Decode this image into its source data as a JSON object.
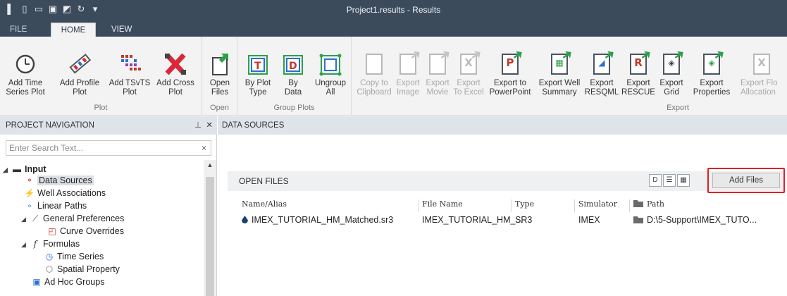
{
  "window": {
    "title": "Project1.results - Results"
  },
  "tabs": {
    "file": "FILE",
    "home": "HOME",
    "view": "VIEW"
  },
  "ribbon": {
    "plot_group": {
      "label": "Plot",
      "buttons": [
        {
          "line1": "Add Time",
          "line2": "Series Plot"
        },
        {
          "line1": "Add Profile",
          "line2": "Plot"
        },
        {
          "line1": "Add TSvTS",
          "line2": "Plot"
        },
        {
          "line1": "Add Cross",
          "line2": "Plot"
        }
      ]
    },
    "open_group": {
      "label": "Open",
      "buttons": [
        {
          "line1": "Open",
          "line2": "Files"
        }
      ]
    },
    "group_plots_group": {
      "label": "Group Plots",
      "buttons": [
        {
          "line1": "By Plot",
          "line2": "Type"
        },
        {
          "line1": "By",
          "line2": "Data"
        },
        {
          "line1": "Ungroup",
          "line2": "All"
        }
      ]
    },
    "export_group": {
      "label": "Export",
      "buttons": [
        {
          "line1": "Copy to",
          "line2": "Clipboard",
          "enabled": false
        },
        {
          "line1": "Export",
          "line2": "Image",
          "enabled": false
        },
        {
          "line1": "Export",
          "line2": "Movie",
          "enabled": false
        },
        {
          "line1": "Export",
          "line2": "To Excel",
          "enabled": false
        },
        {
          "line1": "Export to",
          "line2": "PowerPoint",
          "enabled": true
        },
        {
          "line1": "Export Well",
          "line2": "Summary",
          "enabled": true
        },
        {
          "line1": "Export",
          "line2": "RESQML",
          "enabled": true
        },
        {
          "line1": "Export",
          "line2": "RESCUE",
          "enabled": true
        },
        {
          "line1": "Export",
          "line2": "Grid",
          "enabled": true
        },
        {
          "line1": "Export",
          "line2": "Properties",
          "enabled": true
        },
        {
          "line1": "Export Flo",
          "line2": "Allocation",
          "enabled": false
        }
      ]
    }
  },
  "project_navigation": {
    "title": "PROJECT NAVIGATION",
    "search_placeholder": "Enter Search Text...",
    "tree": [
      {
        "label": "Input",
        "icon": "folder-icon"
      },
      {
        "label": "Data Sources",
        "icon": "data-sources-icon",
        "selected": true
      },
      {
        "label": "Well Associations",
        "icon": "well-associations-icon"
      },
      {
        "label": "Linear Paths",
        "icon": "linear-paths-icon"
      },
      {
        "label": "General Preferences",
        "icon": "wrench-icon"
      },
      {
        "label": "Curve Overrides",
        "icon": "curve-overrides-icon"
      },
      {
        "label": "Formulas",
        "icon": "fx-icon"
      },
      {
        "label": "Time Series",
        "icon": "clock-icon"
      },
      {
        "label": "Spatial Property",
        "icon": "cube-icon"
      },
      {
        "label": "Ad Hoc Groups",
        "icon": "groups-icon"
      }
    ]
  },
  "data_sources": {
    "title": "DATA SOURCES",
    "open_files_title": "OPEN FILES",
    "add_files_label": "Add Files",
    "columns": [
      "Name/Alias",
      "File Name",
      "Type",
      "Simulator",
      "Path"
    ],
    "rows": [
      {
        "name": "IMEX_TUTORIAL_HM_Matched.sr3",
        "file_name": "IMEX_TUTORIAL_HM_...",
        "type": "SR3",
        "simulator": "IMEX",
        "path": "D:\\5-Support\\IMEX_TUTO..."
      }
    ]
  },
  "colors": {
    "titlebar": "#3c4b5c",
    "highlight_red": "#e02020",
    "accent_green": "#2aa24a"
  }
}
